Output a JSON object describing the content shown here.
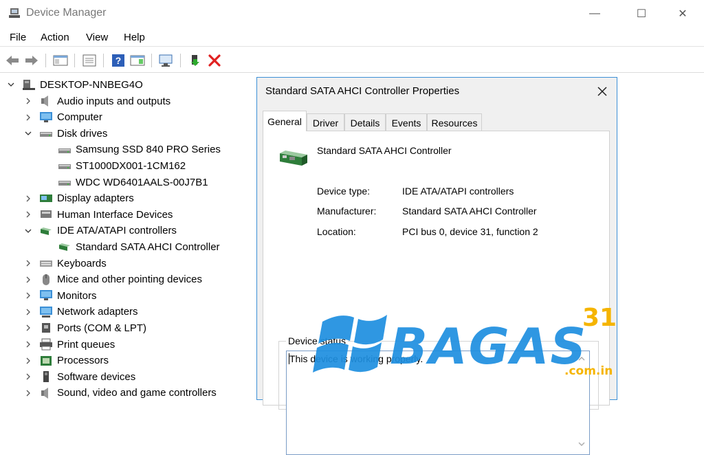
{
  "window": {
    "title": "Device Manager",
    "controls": {
      "minimize": "—",
      "maximize": "☐",
      "close": "✕"
    }
  },
  "menu": [
    "File",
    "Action",
    "View",
    "Help"
  ],
  "toolbar": {
    "buttons": [
      "back-icon",
      "forward-icon",
      "show-hide-console-tree-icon",
      "properties-icon",
      "help-icon",
      "action-pane-icon",
      "scan-hardware-icon",
      "enable-device-icon",
      "uninstall-device-icon"
    ]
  },
  "tree": {
    "root": "DESKTOP-NNBEG4O",
    "items": [
      {
        "label": "Audio inputs and outputs",
        "expanded": false,
        "icon": "speaker-icon"
      },
      {
        "label": "Computer",
        "expanded": false,
        "icon": "monitor-icon"
      },
      {
        "label": "Disk drives",
        "expanded": true,
        "icon": "disk-icon"
      },
      {
        "label": "Samsung SSD 840 PRO Series",
        "child": true,
        "icon": "disk-icon"
      },
      {
        "label": "ST1000DX001-1CM162",
        "child": true,
        "icon": "disk-icon"
      },
      {
        "label": "WDC WD6401AALS-00J7B1",
        "child": true,
        "icon": "disk-icon"
      },
      {
        "label": "Display adapters",
        "expanded": false,
        "icon": "display-adapter-icon"
      },
      {
        "label": "Human Interface Devices",
        "expanded": false,
        "icon": "hid-icon"
      },
      {
        "label": "IDE ATA/ATAPI controllers",
        "expanded": true,
        "icon": "controller-icon"
      },
      {
        "label": "Standard SATA AHCI Controller",
        "child": true,
        "icon": "controller-icon"
      },
      {
        "label": "Keyboards",
        "expanded": false,
        "icon": "keyboard-icon"
      },
      {
        "label": "Mice and other pointing devices",
        "expanded": false,
        "icon": "mouse-icon"
      },
      {
        "label": "Monitors",
        "expanded": false,
        "icon": "monitor-icon"
      },
      {
        "label": "Network adapters",
        "expanded": false,
        "icon": "network-icon"
      },
      {
        "label": "Ports (COM & LPT)",
        "expanded": false,
        "icon": "port-icon"
      },
      {
        "label": "Print queues",
        "expanded": false,
        "icon": "printer-icon"
      },
      {
        "label": "Processors",
        "expanded": false,
        "icon": "processor-icon"
      },
      {
        "label": "Software devices",
        "expanded": false,
        "icon": "software-device-icon"
      },
      {
        "label": "Sound, video and game controllers",
        "expanded": false,
        "icon": "sound-icon"
      }
    ]
  },
  "dialog": {
    "title": "Standard SATA AHCI Controller Properties",
    "tabs": [
      "General",
      "Driver",
      "Details",
      "Events",
      "Resources"
    ],
    "active_tab": "General",
    "device_name": "Standard SATA AHCI Controller",
    "properties": [
      {
        "label": "Device type:",
        "value": "IDE ATA/ATAPI controllers"
      },
      {
        "label": "Manufacturer:",
        "value": "Standard SATA AHCI Controller"
      },
      {
        "label": "Location:",
        "value": "PCI bus 0, device 31, function 2"
      }
    ],
    "status_legend": "Device status",
    "status_text": "This device is working properly."
  },
  "watermark": {
    "brand": "BAGAS",
    "number": "31",
    "domain": ".com.in"
  },
  "colors": {
    "accent": "#3b8fd6",
    "watermark_blue": "#1e8fe0",
    "watermark_gold": "#f5b400",
    "delete_red": "#e02020"
  }
}
